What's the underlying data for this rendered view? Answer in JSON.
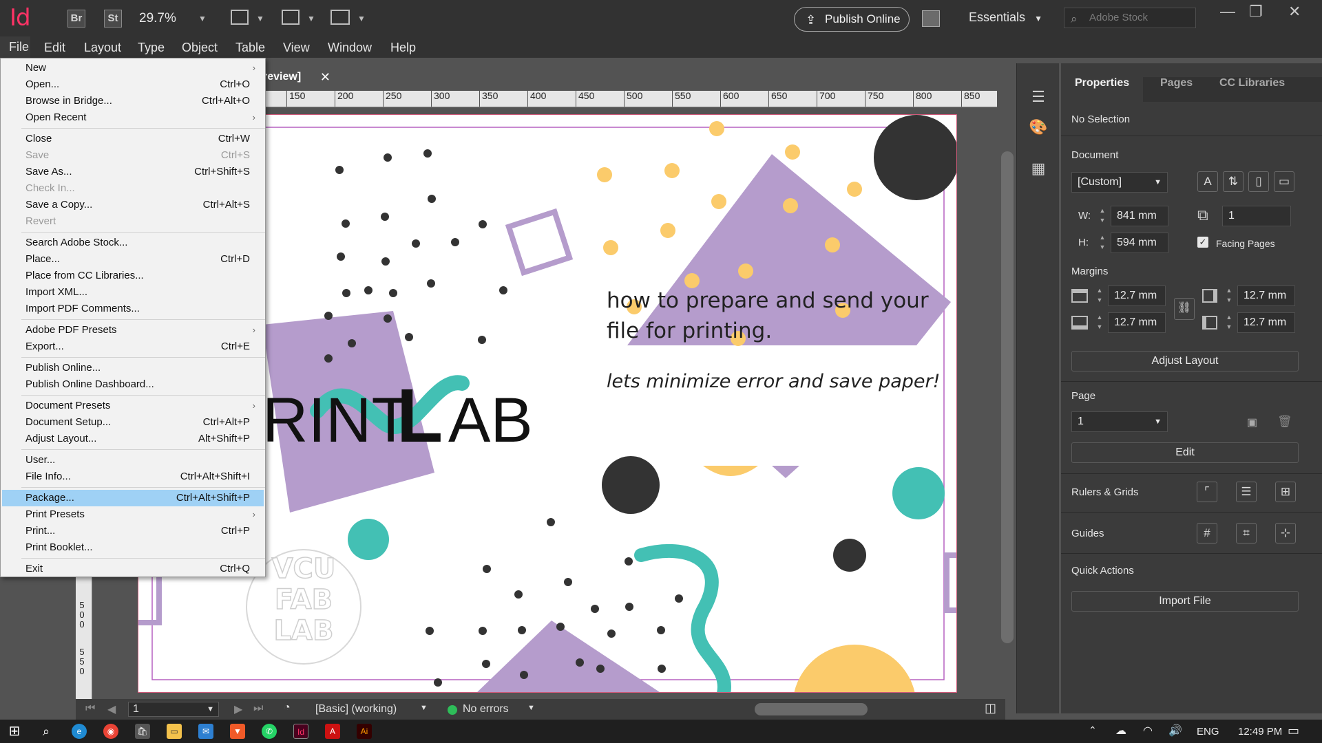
{
  "app": {
    "logo": "Id",
    "bridge": "Br",
    "stock": "St",
    "zoom": "29.7%",
    "publish_online": "Publish Online",
    "workspace": "Essentials",
    "search_placeholder": "Adobe Stock"
  },
  "menubar": [
    "File",
    "Edit",
    "Layout",
    "Type",
    "Object",
    "Table",
    "View",
    "Window",
    "Help"
  ],
  "doc_tab": {
    "label": "review]"
  },
  "ruler": [
    "150",
    "200",
    "250",
    "300",
    "350",
    "400",
    "450",
    "500",
    "550",
    "600",
    "650",
    "700",
    "750",
    "800",
    "850"
  ],
  "ruler_v": [
    "5",
    "0",
    "0",
    "5",
    "5",
    "0"
  ],
  "page": {
    "headline_1": "how to prepare and send your",
    "headline_2": "file for printing.",
    "tagline": "lets minimize error and save paper!",
    "logo_main": "RINT",
    "logo_l": "L",
    "logo_end": "AB",
    "watermark": [
      "VCU",
      "FAB",
      "LAB"
    ]
  },
  "file_menu": {
    "items": [
      {
        "label": "New",
        "shortcut": "",
        "submenu": "›"
      },
      {
        "label": "Open...",
        "shortcut": "Ctrl+O"
      },
      {
        "label": "Browse in Bridge...",
        "shortcut": "Ctrl+Alt+O"
      },
      {
        "label": "Open Recent",
        "shortcut": "",
        "submenu": "›"
      },
      {
        "label": "Close",
        "shortcut": "Ctrl+W"
      },
      {
        "label": "Save",
        "shortcut": "Ctrl+S"
      },
      {
        "label": "Save As...",
        "shortcut": "Ctrl+Shift+S"
      },
      {
        "label": "Check In...",
        "shortcut": ""
      },
      {
        "label": "Save a Copy...",
        "shortcut": "Ctrl+Alt+S"
      },
      {
        "label": "Revert",
        "shortcut": ""
      },
      {
        "label": "Search Adobe Stock...",
        "shortcut": ""
      },
      {
        "label": "Place...",
        "shortcut": "Ctrl+D"
      },
      {
        "label": "Place from CC Libraries...",
        "shortcut": ""
      },
      {
        "label": "Import XML...",
        "shortcut": ""
      },
      {
        "label": "Import PDF Comments...",
        "shortcut": ""
      },
      {
        "label": "Adobe PDF Presets",
        "shortcut": "",
        "submenu": "›"
      },
      {
        "label": "Export...",
        "shortcut": "Ctrl+E"
      },
      {
        "label": "Publish Online...",
        "shortcut": ""
      },
      {
        "label": "Publish Online Dashboard...",
        "shortcut": ""
      },
      {
        "label": "Document Presets",
        "shortcut": "",
        "submenu": "›"
      },
      {
        "label": "Document Setup...",
        "shortcut": "Ctrl+Alt+P"
      },
      {
        "label": "Adjust Layout...",
        "shortcut": "Alt+Shift+P"
      },
      {
        "label": "User...",
        "shortcut": ""
      },
      {
        "label": "File Info...",
        "shortcut": "Ctrl+Alt+Shift+I"
      },
      {
        "label": "Package...",
        "shortcut": "Ctrl+Alt+Shift+P"
      },
      {
        "label": "Print Presets",
        "shortcut": "",
        "submenu": "›"
      },
      {
        "label": "Print...",
        "shortcut": "Ctrl+P"
      },
      {
        "label": "Print Booklet...",
        "shortcut": ""
      },
      {
        "label": "Exit",
        "shortcut": "Ctrl+Q"
      }
    ]
  },
  "status": {
    "page": "1",
    "profile": "[Basic] (working)",
    "preflight": "No errors"
  },
  "properties": {
    "tabs": [
      "Properties",
      "Pages",
      "CC Libraries"
    ],
    "selection": "No Selection",
    "document_label": "Document",
    "preset": "[Custom]",
    "w_label": "W:",
    "h_label": "H:",
    "width": "841 mm",
    "height": "594 mm",
    "pages_count": "1",
    "facing_pages": "Facing Pages",
    "margins_label": "Margins",
    "margin_top": "12.7 mm",
    "margin_bottom": "12.7 mm",
    "margin_left": "12.7 mm",
    "margin_right": "12.7 mm",
    "adjust_layout": "Adjust Layout",
    "page_label": "Page",
    "page_value": "1",
    "edit": "Edit",
    "rulers_grids": "Rulers & Grids",
    "guides": "Guides",
    "quick_actions": "Quick Actions",
    "import_file": "Import File"
  },
  "taskbar": {
    "lang": "ENG",
    "time": "12:49 PM"
  },
  "colors": {
    "purple": "#b59ccc",
    "teal": "#43c0b4",
    "yellow": "#fbcb6b",
    "dark": "#333333",
    "menu_highlight": "#9fd1f5",
    "indesign": "#ff3366"
  }
}
